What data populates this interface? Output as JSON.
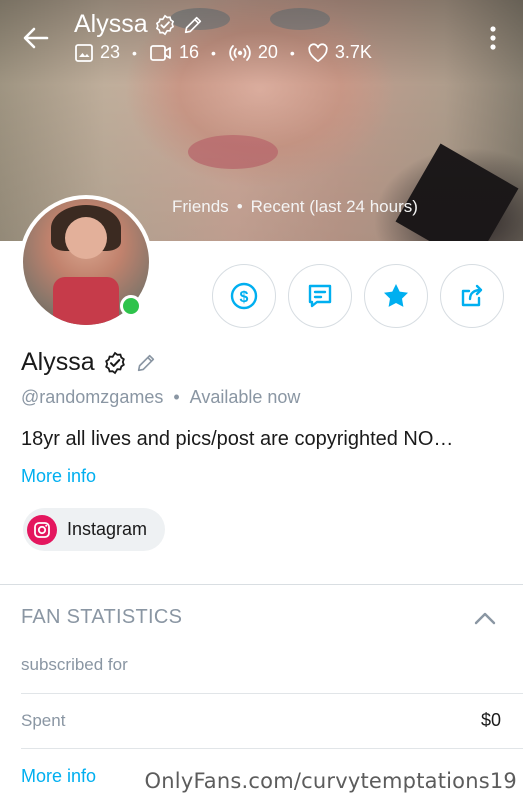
{
  "header": {
    "title": "Alyssa",
    "stats": {
      "photos": "23",
      "videos": "16",
      "streams": "20",
      "likes": "3.7K"
    },
    "last_seen": {
      "friends": "Friends",
      "separator": "•",
      "recent": "Recent (last 24 hours)"
    }
  },
  "profile": {
    "name": "Alyssa",
    "handle": "@randomzgames",
    "status_separator": "•",
    "status": "Available now",
    "bio": "18yr all lives and pics/post are copyrighted NO…",
    "more_info": "More info",
    "social": {
      "label": "Instagram"
    }
  },
  "fan_statistics": {
    "title": "FAN STATISTICS",
    "subscribed_for": "subscribed for",
    "spent_label": "Spent",
    "spent_value": "$0",
    "more_info": "More info"
  },
  "watermark": "OnlyFans.com/curvytemptations19",
  "colors": {
    "accent": "#00aff0",
    "online": "#2ec34b",
    "instagram": "#e4165e",
    "muted_text": "#8a96a3"
  },
  "icons": [
    "back-arrow-icon",
    "more-vertical-icon",
    "verified-icon",
    "edit-pencil-icon",
    "image-icon",
    "video-icon",
    "live-stream-icon",
    "heart-icon",
    "tip-dollar-icon",
    "message-icon",
    "star-icon",
    "share-icon",
    "instagram-icon",
    "chevron-up-icon"
  ]
}
